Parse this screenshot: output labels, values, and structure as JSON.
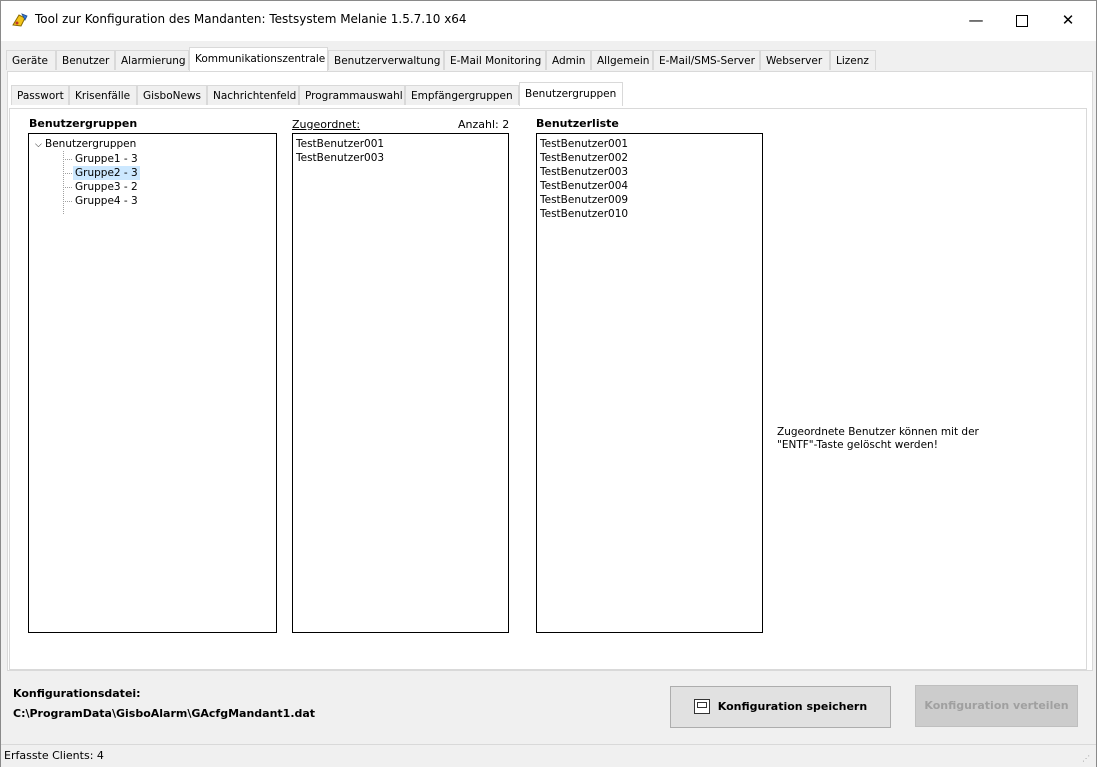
{
  "window": {
    "title": "Tool zur Konfiguration des Mandanten: Testsystem Melanie 1.5.7.10 x64",
    "minimize": "—",
    "close": "✕"
  },
  "main_tabs": [
    "Geräte",
    "Benutzer",
    "Alarmierung",
    "Kommunikationszentrale",
    "Benutzerverwaltung",
    "E-Mail Monitoring",
    "Admin",
    "Allgemein",
    "E-Mail/SMS-Server",
    "Webserver",
    "Lizenz"
  ],
  "main_tab_active": "Kommunikationszentrale",
  "sub_tabs": [
    "Passwort",
    "Krisenfälle",
    "GisboNews",
    "Nachrichtenfeld",
    "Programmauswahl",
    "Empfängergruppen",
    "Benutzergruppen"
  ],
  "sub_tab_active": "Benutzergruppen",
  "groups_panel": {
    "heading": "Benutzergruppen",
    "root": "Benutzergruppen",
    "items": [
      "Gruppe1 - 3",
      "Gruppe2 - 3",
      "Gruppe3 - 2",
      "Gruppe4 - 3"
    ],
    "selected": "Gruppe2 - 3"
  },
  "assigned_panel": {
    "heading": "Zugeordnet:",
    "count_label": "Anzahl: 2",
    "items": [
      "TestBenutzer001",
      "TestBenutzer003"
    ]
  },
  "userlist_panel": {
    "heading": "Benutzerliste",
    "items": [
      "TestBenutzer001",
      "TestBenutzer002",
      "TestBenutzer003",
      "TestBenutzer004",
      "TestBenutzer009",
      "TestBenutzer010"
    ]
  },
  "info_text_line1": "Zugeordnete Benutzer können mit der",
  "info_text_line2": "\"ENTF\"-Taste gelöscht werden!",
  "footer": {
    "config_label": "Konfigurationsdatei:",
    "config_path": "C:\\ProgramData\\GisboAlarm\\GAcfgMandant1.dat",
    "save_button": "Konfiguration speichern",
    "distribute_button": "Konfiguration verteilen"
  },
  "status": {
    "text": "Erfasste Clients: 4"
  }
}
